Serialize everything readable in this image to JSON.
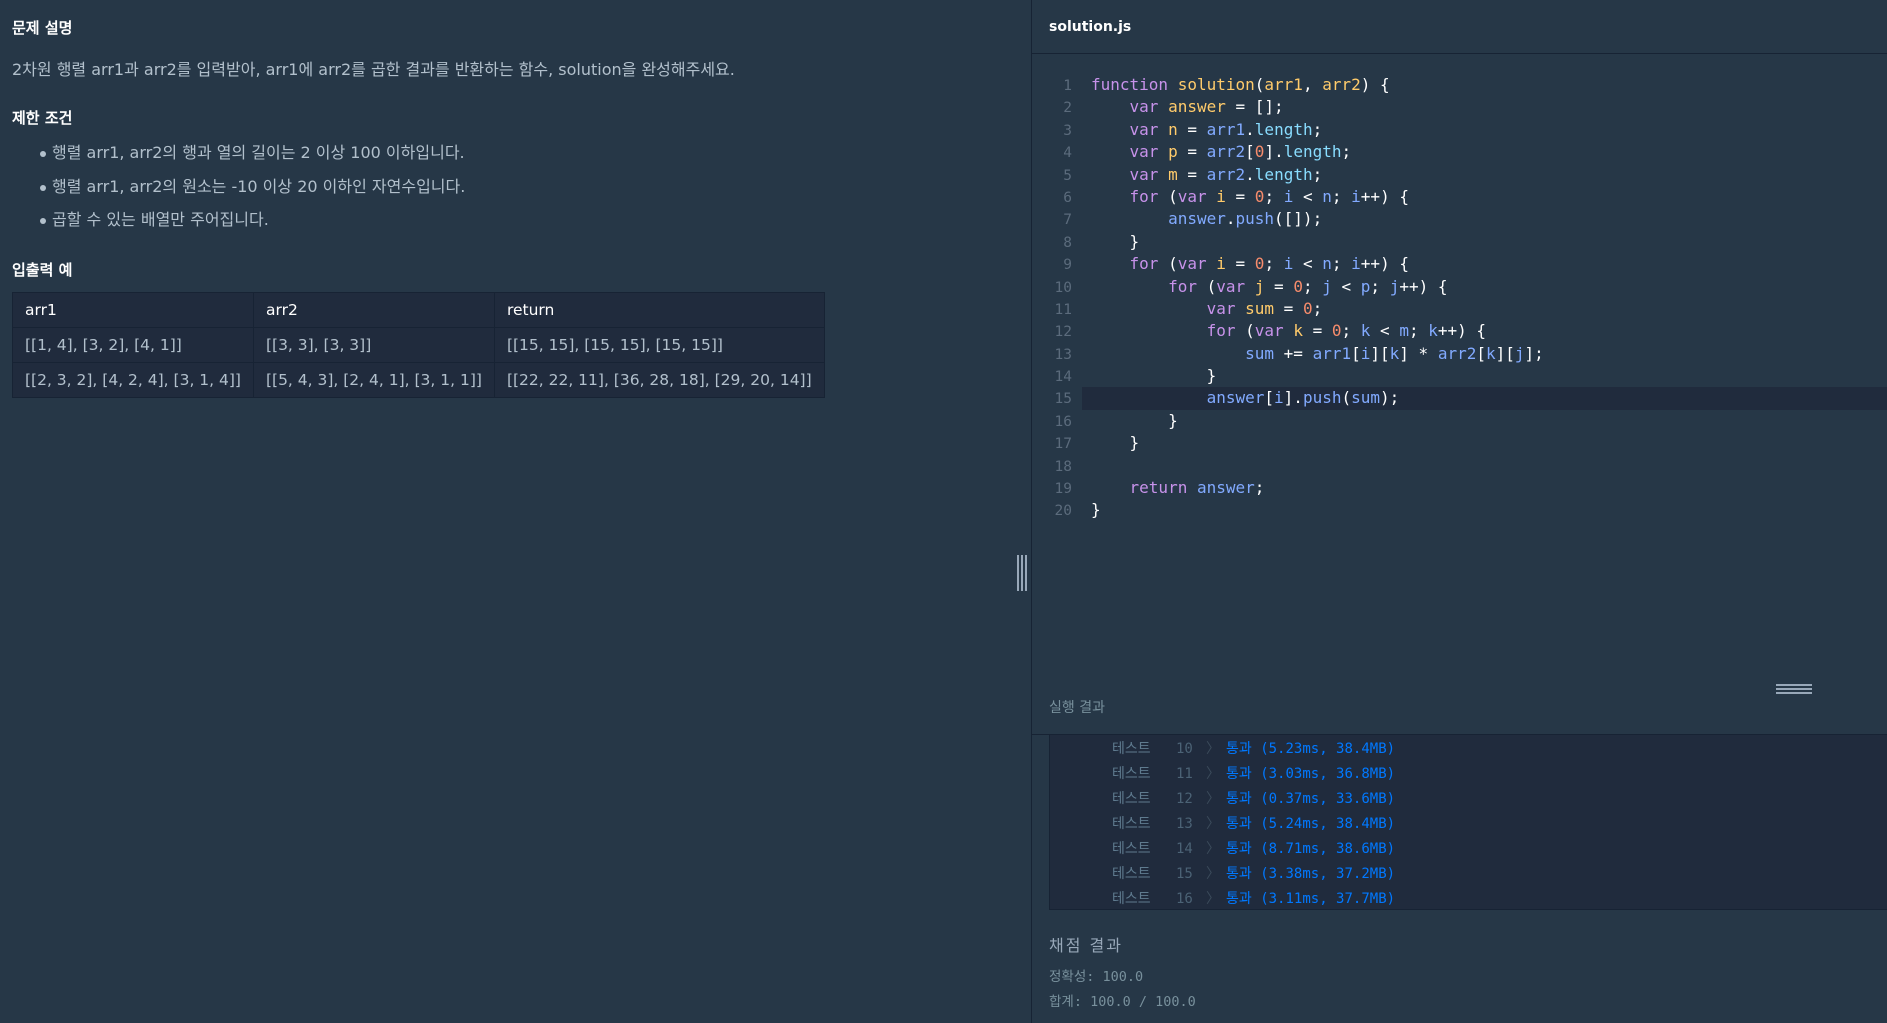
{
  "problem": {
    "desc_title": "문제 설명",
    "desc_text": "2차원 행렬 arr1과 arr2를 입력받아, arr1에 arr2를 곱한 결과를 반환하는 함수, solution을 완성해주세요.",
    "constraints_title": "제한 조건",
    "constraints": [
      "행렬 arr1, arr2의 행과 열의 길이는 2 이상 100 이하입니다.",
      "행렬 arr1, arr2의 원소는 -10 이상 20 이하인 자연수입니다.",
      "곱할 수 있는 배열만 주어집니다."
    ],
    "examples_title": "입출력 예",
    "table": {
      "headers": [
        "arr1",
        "arr2",
        "return"
      ],
      "rows": [
        [
          "[[1, 4], [3, 2], [4, 1]]",
          "[[3, 3], [3, 3]]",
          "[[15, 15], [15, 15], [15, 15]]"
        ],
        [
          "[[2, 3, 2], [4, 2, 4], [3, 1, 4]]",
          "[[5, 4, 3], [2, 4, 1], [3, 1, 1]]",
          "[[22, 22, 11], [36, 28, 18], [29, 20, 14]]"
        ]
      ]
    }
  },
  "editor": {
    "filename": "solution.js",
    "active_line": 15,
    "lines": [
      "function solution(arr1, arr2) {",
      "    var answer = [];",
      "    var n = arr1.length;",
      "    var p = arr2[0].length;",
      "    var m = arr2.length;",
      "    for (var i = 0; i < n; i++) {",
      "        answer.push([]);",
      "    }",
      "    for (var i = 0; i < n; i++) {",
      "        for (var j = 0; j < p; j++) {",
      "            var sum = 0;",
      "            for (var k = 0; k < m; k++) {",
      "                sum += arr1[i][k] * arr2[k][j];",
      "            }",
      "            answer[i].push(sum);",
      "        }",
      "    }",
      "",
      "    return answer;",
      "}"
    ]
  },
  "results": {
    "title": "실행 결과",
    "tests": [
      {
        "label": "테스트",
        "num": "10",
        "arrow": "〉",
        "result": "통과 (5.23ms, 38.4MB)"
      },
      {
        "label": "테스트",
        "num": "11",
        "arrow": "〉",
        "result": "통과 (3.03ms, 36.8MB)"
      },
      {
        "label": "테스트",
        "num": "12",
        "arrow": "〉",
        "result": "통과 (0.37ms, 33.6MB)"
      },
      {
        "label": "테스트",
        "num": "13",
        "arrow": "〉",
        "result": "통과 (5.24ms, 38.4MB)"
      },
      {
        "label": "테스트",
        "num": "14",
        "arrow": "〉",
        "result": "통과 (8.71ms, 38.6MB)"
      },
      {
        "label": "테스트",
        "num": "15",
        "arrow": "〉",
        "result": "통과 (3.38ms, 37.2MB)"
      },
      {
        "label": "테스트",
        "num": "16",
        "arrow": "〉",
        "result": "통과 (3.11ms, 37.7MB)"
      }
    ],
    "grade_title": "채점 결과",
    "accuracy": "정확성: 100.0",
    "total": "합계: 100.0 / 100.0"
  }
}
